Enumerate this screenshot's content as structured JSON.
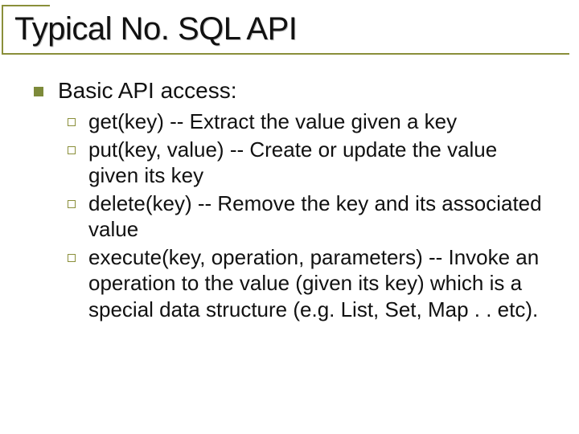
{
  "title": "Typical No. SQL API",
  "heading": "Basic API access:",
  "items": [
    "get(key) -- Extract the value given a key",
    "put(key, value) -- Create or update the value given its key",
    "delete(key) -- Remove the key and its associated value",
    "execute(key, operation, parameters) -- Invoke an operation to the value (given its key) which is a special data structure (e.g. List, Set, Map . . etc)."
  ]
}
